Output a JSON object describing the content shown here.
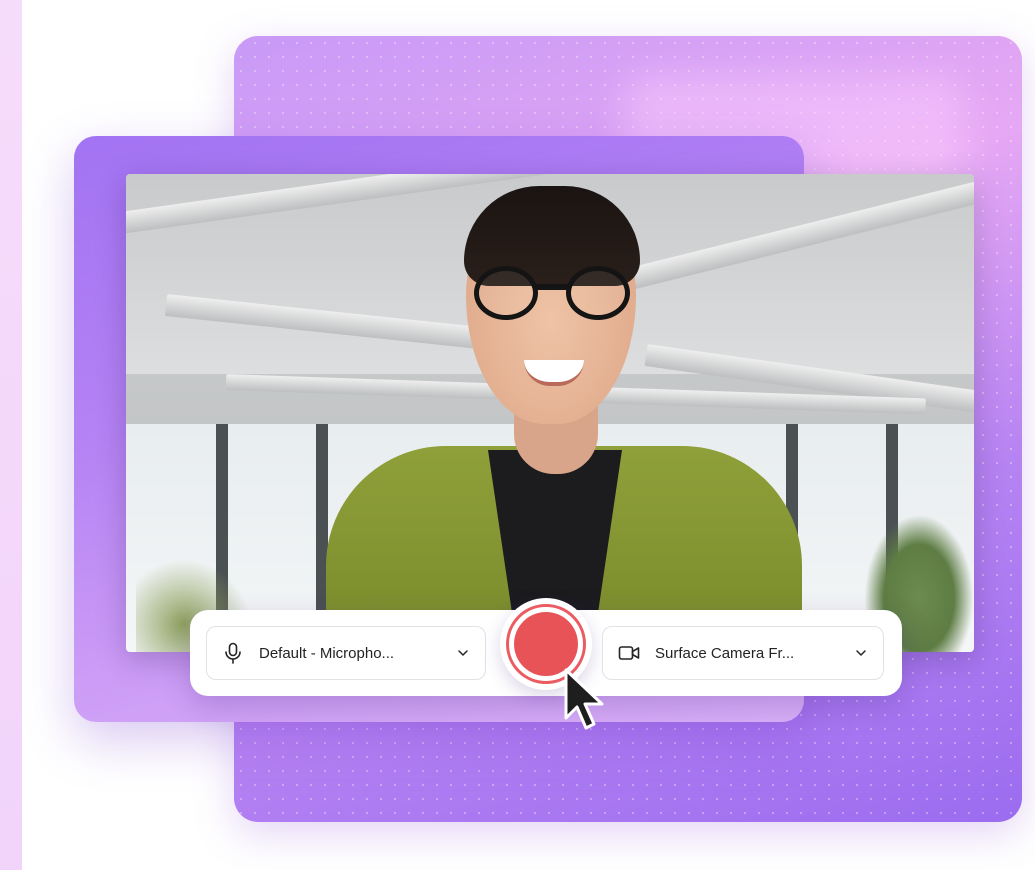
{
  "controls": {
    "microphone_label": "Default - Micropho...",
    "camera_label": "Surface Camera Fr..."
  },
  "icons": {
    "microphone": "microphone-icon",
    "camera": "video-camera-icon",
    "chevron": "chevron-down-icon",
    "record": "record-icon",
    "cursor": "mouse-pointer-icon"
  },
  "colors": {
    "record": "#e85358",
    "record_ring": "#ea5b62",
    "frame_purple": "#a273f3",
    "back_purple": "#c89af6"
  }
}
